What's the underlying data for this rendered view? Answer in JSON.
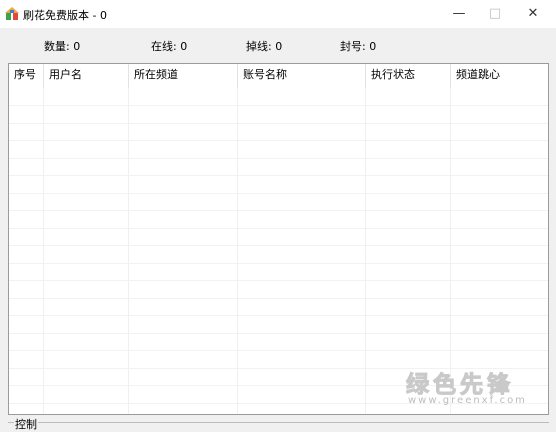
{
  "window": {
    "title": "刷花免费版本   - 0",
    "minimize": "—",
    "maximize": "□",
    "close": "✕"
  },
  "stats": {
    "count": "数量: 0",
    "online": "在线: 0",
    "offline": "掉线: 0",
    "banned": "封号: 0"
  },
  "table": {
    "columns": [
      "序号",
      "用户名",
      "所在频道",
      "账号名称",
      "执行状态",
      "频道跳心"
    ],
    "rows": []
  },
  "watermark": {
    "text": "绿色先锋",
    "url": "www.greenxf.com"
  },
  "control_group": {
    "label": "控制"
  }
}
